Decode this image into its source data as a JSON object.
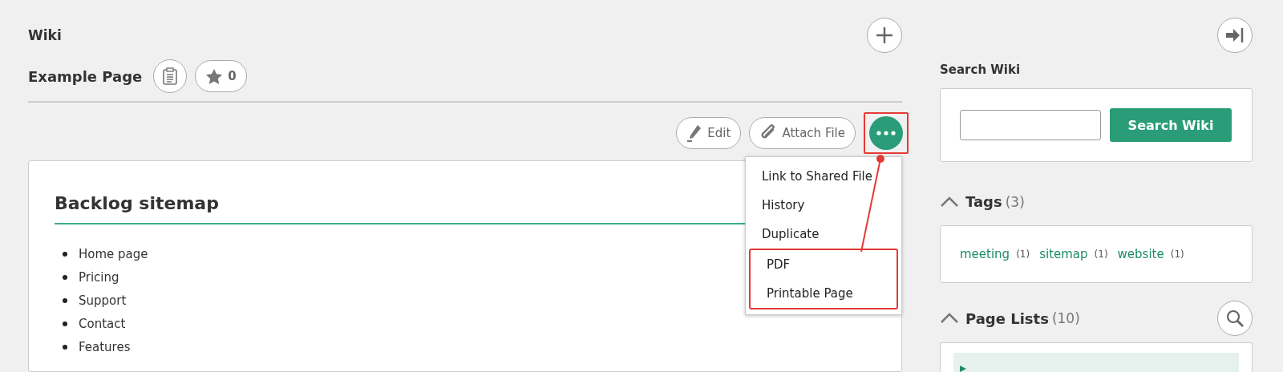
{
  "wiki_title": "Wiki",
  "page": {
    "title": "Example Page",
    "star_count": "0"
  },
  "toolbar": {
    "buttons": [
      {
        "label": "Edit",
        "kind": "edit"
      },
      {
        "label": "Attach File",
        "kind": "attach"
      }
    ],
    "more_highlighted": true
  },
  "more_menu": {
    "expanded": true,
    "items": [
      {
        "label": "Link to Shared File",
        "highlighted": false
      },
      {
        "label": "History",
        "highlighted": false
      },
      {
        "label": "Duplicate",
        "highlighted": false
      },
      {
        "label": "PDF",
        "highlighted": true
      },
      {
        "label": "Printable Page",
        "highlighted": true
      }
    ]
  },
  "content": {
    "heading": "Backlog sitemap",
    "items": [
      "Home page",
      "Pricing",
      "Support",
      "Contact",
      "Features"
    ]
  },
  "sidebar": {
    "search": {
      "title": "Search Wiki",
      "button": "Search Wiki"
    },
    "tags": {
      "title": "Tags",
      "count": "(3)",
      "expanded": true,
      "items": [
        {
          "name": "meeting",
          "count": "(1)"
        },
        {
          "name": "sitemap",
          "count": "(1)"
        },
        {
          "name": "website",
          "count": "(1)"
        }
      ]
    },
    "page_lists": {
      "title": "Page Lists",
      "count": "(10)",
      "expanded": true
    }
  }
}
